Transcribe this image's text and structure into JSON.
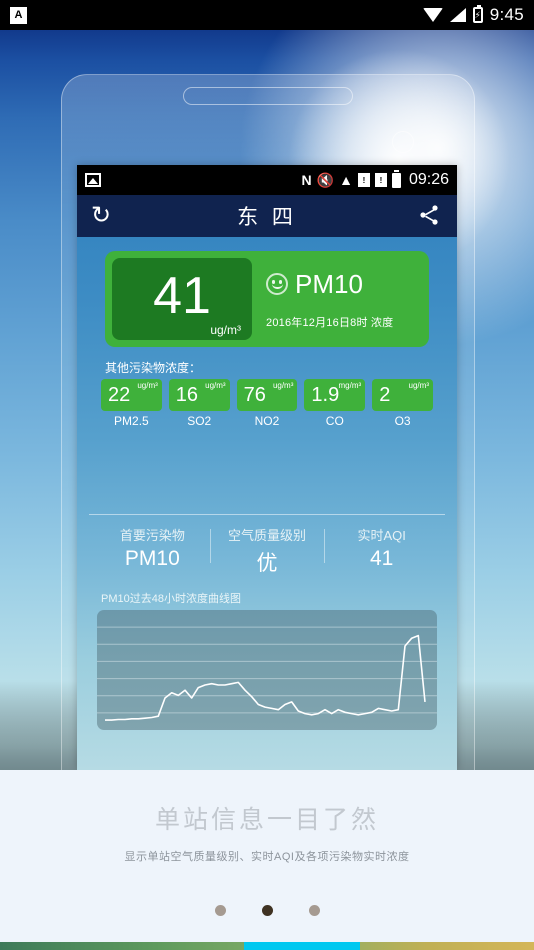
{
  "android_status": {
    "notification_icon": "app-a-icon",
    "notification_letter": "A",
    "wifi_icon": "wifi-icon",
    "signal_icon": "cell-signal-icon",
    "battery_icon": "battery-charging-icon",
    "time": "9:45"
  },
  "phone_status": {
    "picture_icon": "picture-icon",
    "nfc_icon": "N",
    "mute_icon": "volume-mute-icon",
    "wifi_icon": "wifi-icon",
    "sim1_icon": "sim-card-1-icon",
    "sim2_icon": "sim-card-2-icon",
    "battery_icon": "battery-full-icon",
    "time": "09:26"
  },
  "app": {
    "refresh_icon": "refresh-icon",
    "share_icon": "share-icon",
    "title": "东 四"
  },
  "main_card": {
    "value": "41",
    "unit": "ug/m³",
    "face_icon": "smiley-face-icon",
    "pollutant": "PM10",
    "timestamp": "2016年12月16日8时  浓度",
    "card_color": "#3fb13b",
    "value_box_color": "#1d7a22"
  },
  "others": {
    "label": "其他污染物浓度：",
    "items": [
      {
        "value": "22",
        "unit": "ug/m³",
        "name": "PM2.5"
      },
      {
        "value": "16",
        "unit": "ug/m³",
        "name": "SO2"
      },
      {
        "value": "76",
        "unit": "ug/m³",
        "name": "NO2"
      },
      {
        "value": "1.9",
        "unit": "mg/m³",
        "name": "CO"
      },
      {
        "value": "2",
        "unit": "ug/m³",
        "name": "O3"
      }
    ]
  },
  "summary": [
    {
      "label": "首要污染物",
      "value": "PM10"
    },
    {
      "label": "空气质量级别",
      "value": "优"
    },
    {
      "label": "实时AQI",
      "value": "41"
    }
  ],
  "chart_data": {
    "type": "line",
    "title": "PM10过去48小时浓度曲线图",
    "xlabel": "",
    "ylabel": "",
    "grid": true,
    "legend": null,
    "ylim": [
      0,
      160
    ],
    "x": [
      1,
      2,
      3,
      4,
      5,
      6,
      7,
      8,
      9,
      10,
      11,
      12,
      13,
      14,
      15,
      16,
      17,
      18,
      19,
      20,
      21,
      22,
      23,
      24,
      25,
      26,
      27,
      28,
      29,
      30,
      31,
      32,
      33,
      34,
      35,
      36,
      37,
      38,
      39,
      40,
      41,
      42,
      43,
      44,
      45,
      46,
      47,
      48
    ],
    "series": [
      {
        "name": "PM10",
        "values": [
          6,
          6,
          7,
          7,
          8,
          8,
          9,
          10,
          12,
          40,
          48,
          44,
          52,
          40,
          56,
          60,
          62,
          60,
          60,
          62,
          64,
          52,
          42,
          30,
          26,
          24,
          22,
          30,
          34,
          20,
          16,
          14,
          16,
          22,
          16,
          22,
          18,
          16,
          14,
          16,
          18,
          24,
          22,
          20,
          22,
          120,
          132,
          136,
          34
        ]
      }
    ]
  },
  "caption": {
    "title": "单站信息一目了然",
    "subtitle": "显示单站空气质量级别、实时AQI及各项污染物实时浓度"
  },
  "pager": {
    "total": 3,
    "active_index": 1
  }
}
